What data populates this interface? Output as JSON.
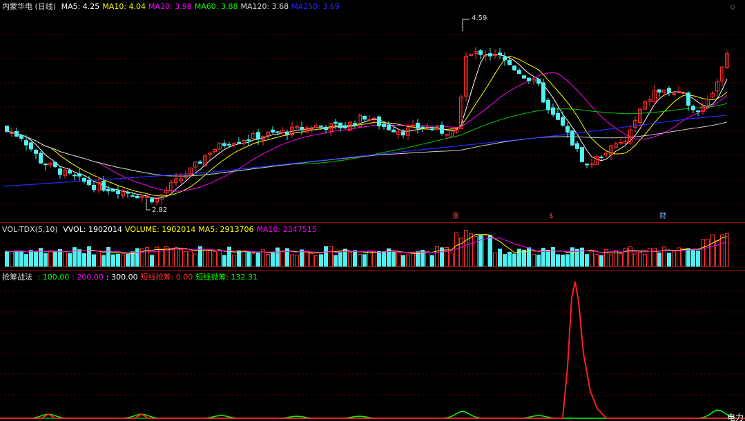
{
  "main": {
    "title": "内蒙华电 (日线)",
    "ma": [
      {
        "label": "MA5: 4.25",
        "color": "#ffffff"
      },
      {
        "label": "MA10: 4.04",
        "color": "#ffff00"
      },
      {
        "label": "MA20: 3.98",
        "color": "#ff00ff"
      },
      {
        "label": "MA60: 3.88",
        "color": "#00ff00"
      },
      {
        "label": "MA120: 3.68",
        "color": "#dddddd"
      },
      {
        "label": "MA250: 3.69",
        "color": "#2a2aff"
      }
    ],
    "high_label": "4.59",
    "low_label": "2.82",
    "markers": [
      {
        "text": "涨",
        "color": "#ff4040"
      },
      {
        "text": "$",
        "color": "#ff4040"
      },
      {
        "text": "财",
        "color": "#7fb0ff"
      }
    ],
    "diamond_icon": "diamond-icon"
  },
  "vol": {
    "title": "VOL-TDX(5,10)",
    "items": [
      {
        "label": "VVOL: 1902014",
        "color": "#ffffff"
      },
      {
        "label": "VOLUME: 1902014",
        "color": "#ffff00"
      },
      {
        "label": "MA5: 2913706",
        "color": "#ffff00"
      },
      {
        "label": "MA10: 2347515",
        "color": "#ff00ff"
      }
    ]
  },
  "ind": {
    "title": "抢筹战法",
    "items": [
      {
        "label": ": 100.00",
        "color": "#00ff00"
      },
      {
        "label": ": 200.00",
        "color": "#ff00ff"
      },
      {
        "label": ": 300.00",
        "color": "#ffffff"
      },
      {
        "label": "短线抢筹: 0.00",
        "color": "#ff3030"
      },
      {
        "label": "短线抛筹: 132.31",
        "color": "#00ff00"
      }
    ],
    "corner_label": "电力"
  },
  "colors": {
    "up": "#ff3030",
    "down": "#50f0f0",
    "grid": "#7a0000"
  }
}
